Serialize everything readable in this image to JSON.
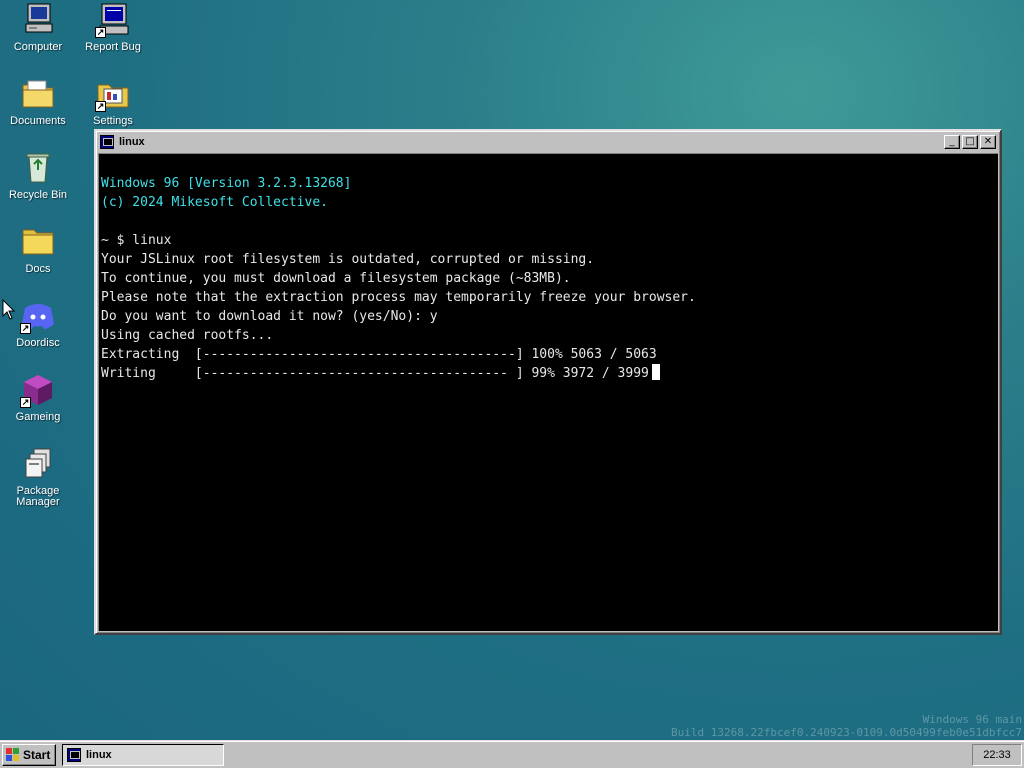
{
  "desktop": {
    "icons": [
      {
        "label": "Computer",
        "icon": "computer-icon",
        "shortcut": false
      },
      {
        "label": "Report Bug",
        "icon": "report-bug-icon",
        "shortcut": true
      },
      {
        "label": "Documents",
        "icon": "documents-folder-icon",
        "shortcut": false
      },
      {
        "label": "Settings",
        "icon": "settings-icon",
        "shortcut": true
      },
      {
        "label": "Recycle Bin",
        "icon": "recycle-bin-icon",
        "shortcut": false
      },
      {
        "label": "Docs",
        "icon": "docs-folder-icon",
        "shortcut": false
      },
      {
        "label": "Doordisc",
        "icon": "discord-icon",
        "shortcut": true
      },
      {
        "label": "Gameing",
        "icon": "cube-icon",
        "shortcut": true
      },
      {
        "label": "Package\nManager",
        "icon": "package-manager-icon",
        "shortcut": false
      }
    ],
    "watermark": {
      "line1": "Windows 96 main",
      "line2": "Build 13268.22fbcef0.240923-0109.0d50499feb0e51dbfcc7"
    }
  },
  "window": {
    "title": "linux",
    "minimize_label": "_",
    "maximize_label": "□",
    "close_label": "✕"
  },
  "terminal": {
    "lines": [
      "Windows 96 [Version 3.2.3.13268]",
      "(c) 2024 Mikesoft Collective.",
      "",
      "~ $ linux",
      "Your JSLinux root filesystem is outdated, corrupted or missing.",
      "To continue, you must download a filesystem package (~83MB).",
      "Please note that the extraction process may temporarily freeze your browser.",
      "Do you want to download it now? (yes/No): y",
      "Using cached rootfs...",
      "Extracting  [----------------------------------------] 100% 5063 / 5063",
      "Writing     [--------------------------------------- ] 99% 3972 / 3999"
    ],
    "header_lines_count_cyan": 2
  },
  "taskbar": {
    "start_label": "Start",
    "task_label": "linux",
    "clock": "22:33"
  },
  "colors": {
    "desktop_bg": "#1f6f83",
    "terminal_bg": "#000000",
    "terminal_header_text": "#3fe0e8",
    "terminal_text": "#e8e8e8",
    "chrome": "#c0c0c0"
  }
}
